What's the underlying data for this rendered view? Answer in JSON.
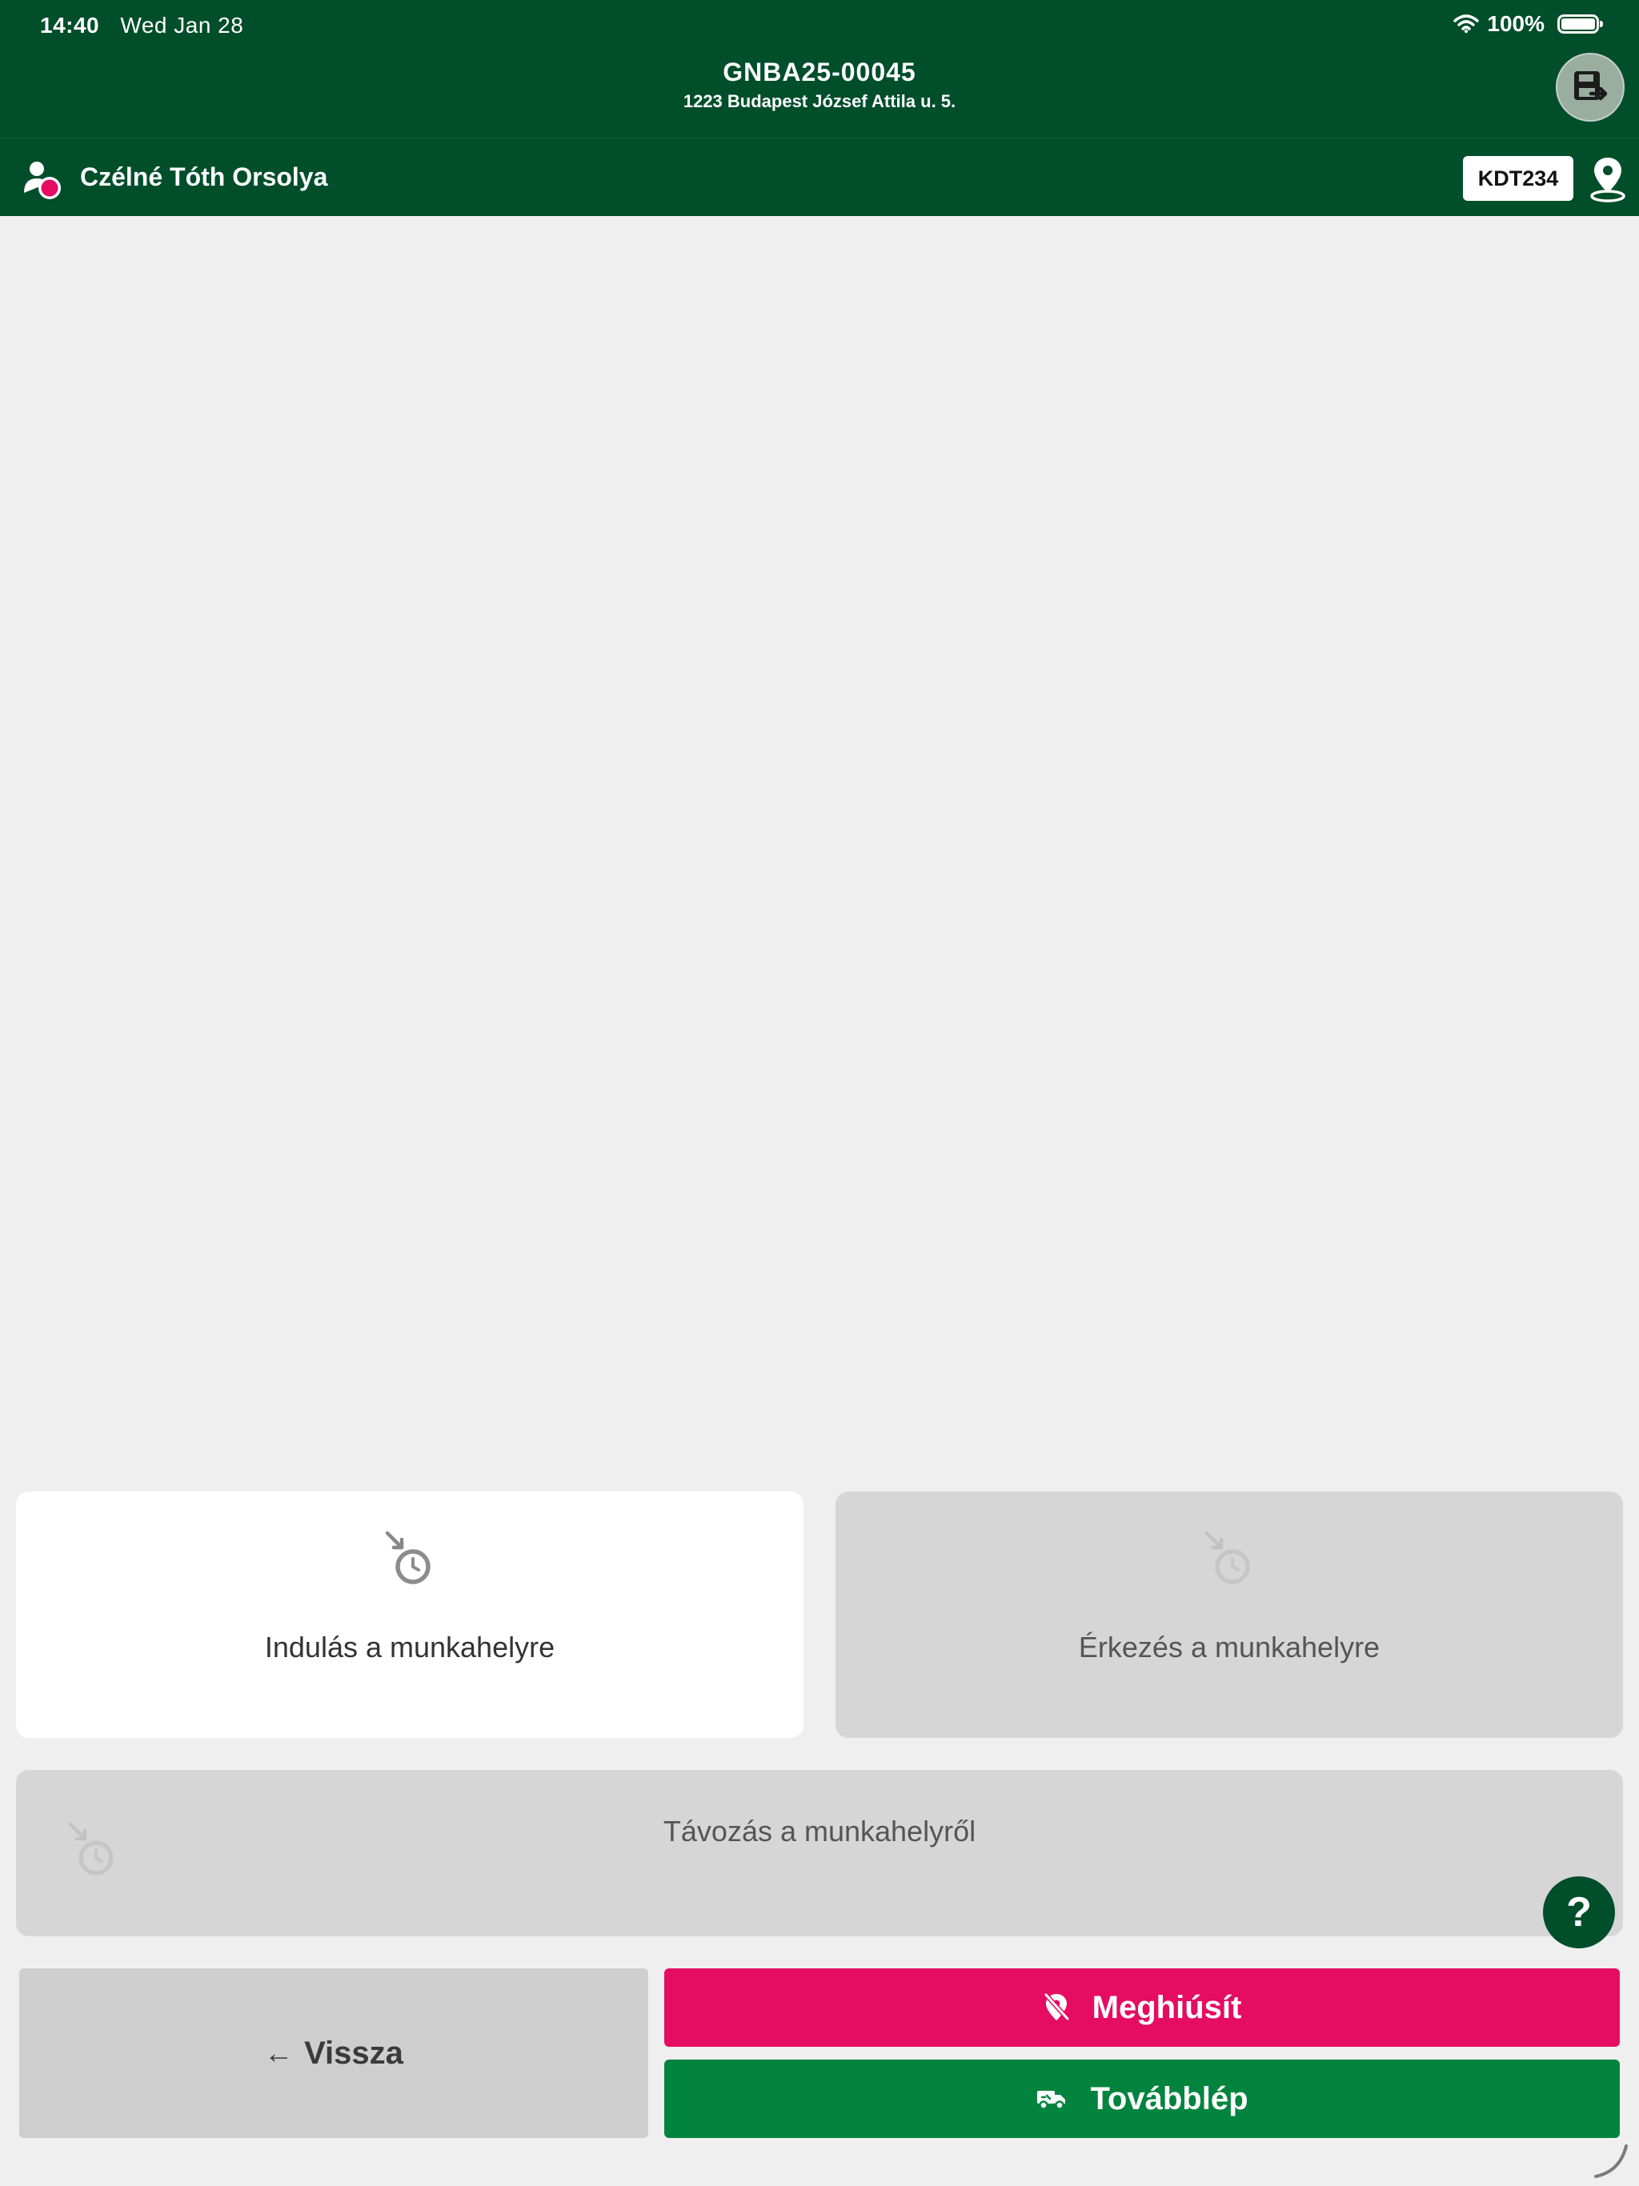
{
  "status_bar": {
    "time": "14:40",
    "date": "Wed Jan 28",
    "battery": "100%"
  },
  "header": {
    "order_id": "GNBA25-00045",
    "address": "1223 Budapest József Attila u. 5.",
    "save_exit_icon": "save-exit-icon"
  },
  "user": {
    "name": "Czélné Tóth Orsolya",
    "icon": "user-status-icon"
  },
  "vehicle": {
    "plate": "KDT234"
  },
  "time_cards": {
    "departure": {
      "label": "Indulás a munkahelyre",
      "icon": "clock-arrow-icon",
      "active": true
    },
    "arrival": {
      "label": "Érkezés a munkahelyre",
      "icon": "clock-arrow-icon",
      "active": false
    },
    "leave": {
      "label": "Távozás a munkahelyről",
      "icon": "clock-arrow-icon",
      "active": false
    }
  },
  "help": {
    "label": "?"
  },
  "footer": {
    "back_arrow": "←",
    "back_label": "Vissza",
    "cancel_label": "Meghiúsít",
    "next_label": "Továbblép"
  },
  "colors": {
    "header_green": "#014e2b",
    "accent_pink": "#e50c62",
    "action_green": "#02843f",
    "background": "#efefef"
  }
}
